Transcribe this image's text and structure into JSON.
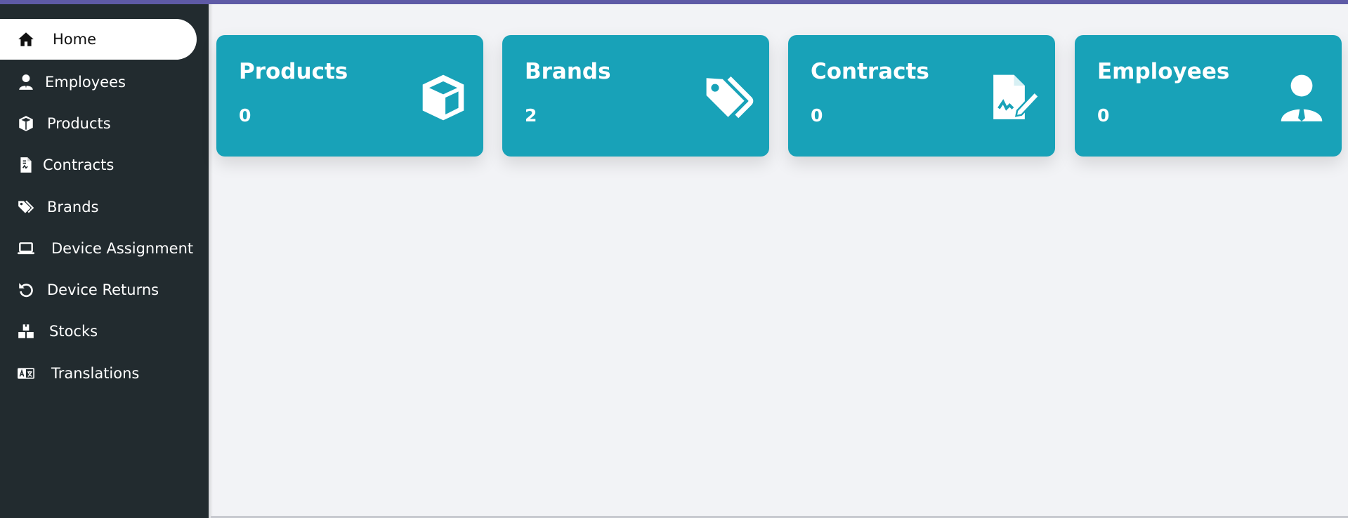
{
  "sidebar": {
    "items": [
      {
        "label": "Home",
        "icon": "home-icon",
        "active": true
      },
      {
        "label": "Employees",
        "icon": "user-icon"
      },
      {
        "label": "Products",
        "icon": "cube-icon"
      },
      {
        "label": "Contracts",
        "icon": "contract-icon"
      },
      {
        "label": "Brands",
        "icon": "tags-icon"
      },
      {
        "label": "Device Assignment",
        "icon": "laptop-icon"
      },
      {
        "label": "Device Returns",
        "icon": "undo-icon"
      },
      {
        "label": "Stocks",
        "icon": "boxes-icon"
      },
      {
        "label": "Translations",
        "icon": "language-icon"
      }
    ]
  },
  "cards": [
    {
      "title": "Products",
      "count": "0",
      "icon": "cube-icon"
    },
    {
      "title": "Brands",
      "count": "2",
      "icon": "tags-icon"
    },
    {
      "title": "Contracts",
      "count": "0",
      "icon": "file-signature-icon"
    },
    {
      "title": "Employees",
      "count": "0",
      "icon": "user-tie-icon"
    }
  ],
  "colors": {
    "topbar": "#5e5aa6",
    "sidebar": "#222b2f",
    "card": "#18a2b8",
    "background": "#f2f3f6"
  }
}
